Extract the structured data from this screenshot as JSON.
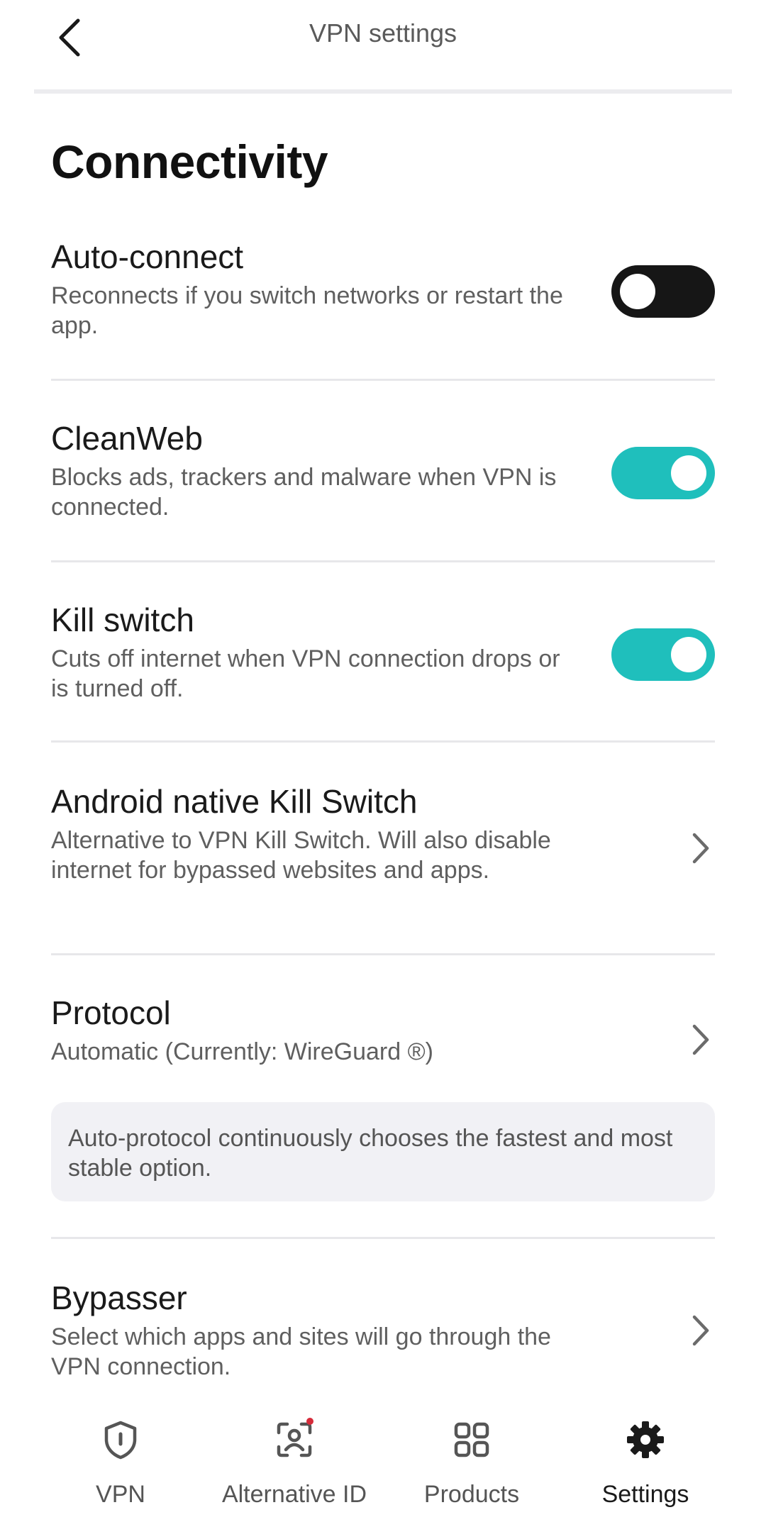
{
  "header": {
    "title": "VPN settings"
  },
  "section": {
    "title": "Connectivity"
  },
  "rows": {
    "auto_connect": {
      "title": "Auto-connect",
      "desc": "Reconnects if you switch networks or restart the app.",
      "toggle": "off"
    },
    "cleanweb": {
      "title": "CleanWeb",
      "desc": "Blocks ads, trackers and malware when VPN is connected.",
      "toggle": "on"
    },
    "kill_switch": {
      "title": "Kill switch",
      "desc": "Cuts off internet when VPN connection drops or is turned off.",
      "toggle": "on"
    },
    "native_kill_switch": {
      "title": "Android native Kill Switch",
      "desc": "Alternative to VPN Kill Switch. Will also disable internet for bypassed websites and apps."
    },
    "protocol": {
      "title": "Protocol",
      "desc": "Automatic (Currently: WireGuard ®)",
      "info": "Auto-protocol continuously chooses the fastest and most stable option."
    },
    "bypasser": {
      "title": "Bypasser",
      "desc": "Select which apps and sites will go through the VPN connection."
    }
  },
  "nav": {
    "items": [
      {
        "label": "VPN",
        "icon": "shield-icon"
      },
      {
        "label": "Alternative ID",
        "icon": "alternative-id-icon",
        "badge": true
      },
      {
        "label": "Products",
        "icon": "grid-icon"
      },
      {
        "label": "Settings",
        "icon": "gear-icon",
        "active": true
      }
    ]
  },
  "colors": {
    "accent": "#1fbfbc",
    "toggle_off": "#161616",
    "badge": "#d62b3a"
  }
}
